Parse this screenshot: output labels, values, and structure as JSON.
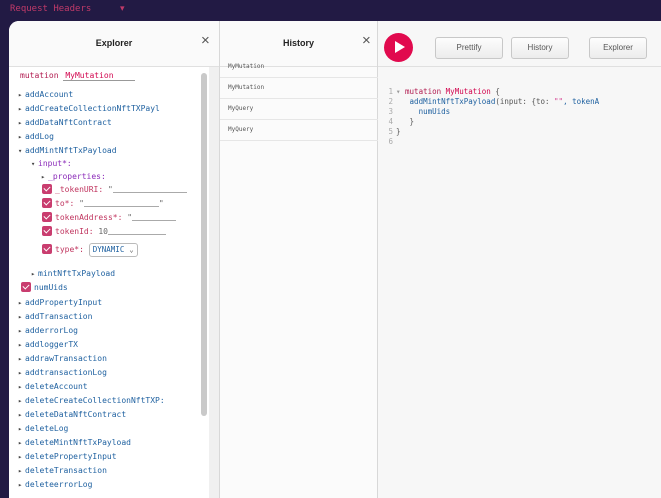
{
  "topbar": {
    "label": "Request Headers",
    "caret": "▾"
  },
  "explorer": {
    "title": "Explorer",
    "close": "×",
    "operation_keyword": "mutation",
    "operation_name": "MyMutation",
    "fields_before": [
      "addAccount",
      "addCreateCollectionNftTXPayl",
      "addDataNftContract",
      "addLog"
    ],
    "expanded_field": "addMintNftTxPayload",
    "input_arg": "input*:",
    "properties": "_properties:",
    "args": [
      {
        "label": "_tokenURI:",
        "value": "\"",
        "value_end": ""
      },
      {
        "label": "to*:",
        "value": "\"",
        "value_end": "\""
      },
      {
        "label": "tokenAddress*:",
        "value": "\"",
        "value_end": "\""
      },
      {
        "label": "tokenId:",
        "value": "10",
        "value_end": ""
      }
    ],
    "type_label": "type*:",
    "type_value": "DYNAMIC",
    "sub_type": "mintNftTxPayload",
    "checked_field": "numUids",
    "fields_after": [
      "addPropertyInput",
      "addTransaction",
      "adderrorLog",
      "addloggerTX",
      "addrawTransaction",
      "addtransactionLog",
      "deleteAccount",
      "deleteCreateCollectionNftTXP:",
      "deleteDataNftContract",
      "deleteLog",
      "deleteMintNftTxPayload",
      "deletePropertyInput",
      "deleteTransaction",
      "deleteerrorLog"
    ]
  },
  "history": {
    "title": "History",
    "close": "×",
    "items": [
      "MyMutation",
      "MyMutation",
      "MyQuery",
      "MyQuery"
    ]
  },
  "editor": {
    "buttons": {
      "prettify": "Prettify",
      "history": "History",
      "explorer": "Explorer"
    },
    "line_numbers": [
      "1",
      "2",
      "3",
      "4",
      "5",
      "6"
    ],
    "fold_marker": "▾",
    "code": {
      "keyword": "mutation",
      "name": "MyMutation",
      "open_brace": "{",
      "field": "addMintNftTxPayload",
      "args_open": "(input: {to: ",
      "empty_string": "\"\"",
      "args_rest": ", tokenA",
      "subfield": "numUids",
      "inner_close": "}",
      "outer_close": "}"
    }
  },
  "colors": {
    "background": "#221a44",
    "accent": "#e10a4e",
    "checkbox": "#c93d6f",
    "field_text": "#1f61a0"
  }
}
